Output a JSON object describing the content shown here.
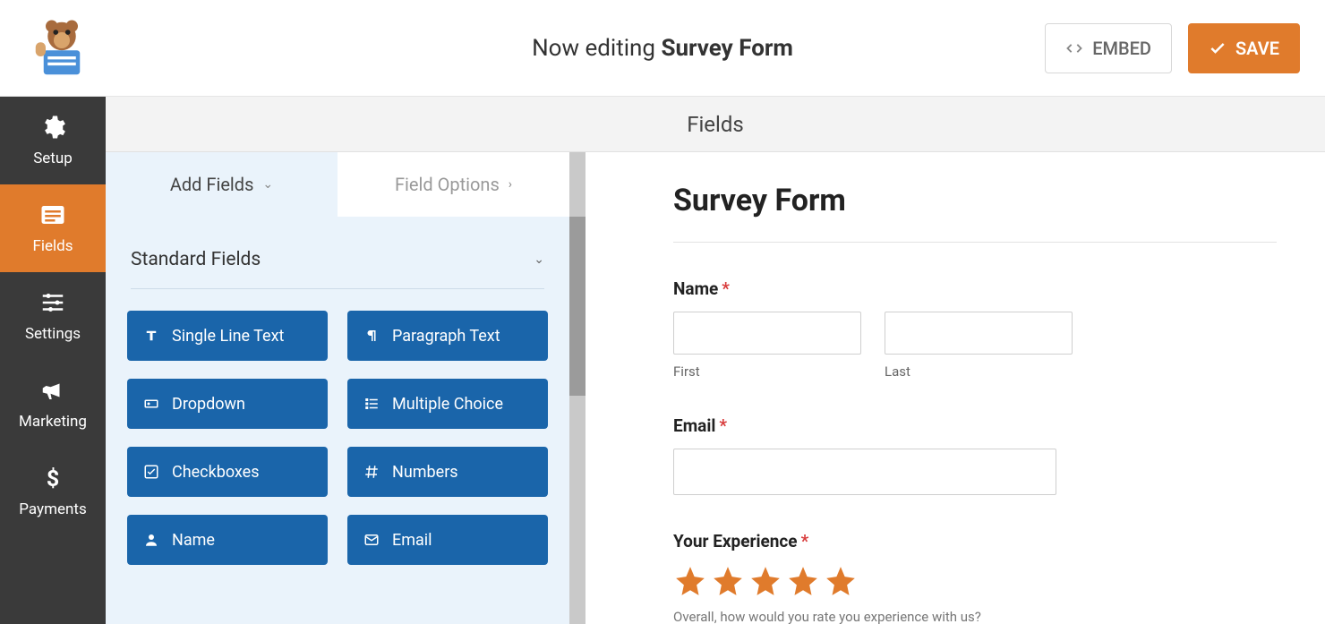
{
  "header": {
    "editing_prefix": "Now editing ",
    "form_name": "Survey Form",
    "embed_label": "EMBED",
    "save_label": "SAVE"
  },
  "panel_title": "Fields",
  "sidebar": {
    "items": [
      {
        "label": "Setup"
      },
      {
        "label": "Fields"
      },
      {
        "label": "Settings"
      },
      {
        "label": "Marketing"
      },
      {
        "label": "Payments"
      }
    ]
  },
  "left_panel": {
    "tabs": {
      "add_fields": "Add Fields",
      "field_options": "Field Options"
    },
    "section_title": "Standard Fields",
    "fields": [
      {
        "name": "single-line-text",
        "label": "Single Line Text"
      },
      {
        "name": "paragraph-text",
        "label": "Paragraph Text"
      },
      {
        "name": "dropdown",
        "label": "Dropdown"
      },
      {
        "name": "multiple-choice",
        "label": "Multiple Choice"
      },
      {
        "name": "checkboxes",
        "label": "Checkboxes"
      },
      {
        "name": "numbers",
        "label": "Numbers"
      },
      {
        "name": "name",
        "label": "Name"
      },
      {
        "name": "email",
        "label": "Email"
      }
    ]
  },
  "preview": {
    "title": "Survey Form",
    "name_label": "Name",
    "first_label": "First",
    "last_label": "Last",
    "email_label": "Email",
    "experience_label": "Your Experience",
    "experience_desc": "Overall, how would you rate you experience with us?",
    "required_mark": "*",
    "star_rating": 5
  }
}
